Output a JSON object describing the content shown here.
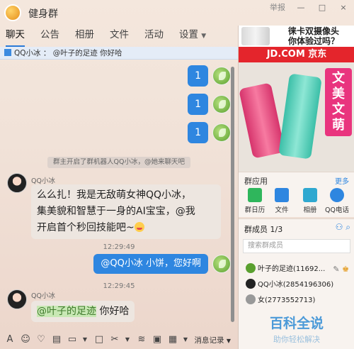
{
  "window": {
    "title": "健身群",
    "report_label": "举报",
    "controls": [
      "—",
      "□",
      "×"
    ]
  },
  "tabs": [
    {
      "label": "聊天",
      "active": true
    },
    {
      "label": "公告"
    },
    {
      "label": "相册"
    },
    {
      "label": "文件"
    },
    {
      "label": "活动"
    },
    {
      "label": "设置",
      "dropdown": true
    }
  ],
  "notice": "QQ小冰 ： @叶子的足迹 你好哈",
  "chat": {
    "messages_right_ones": [
      "1",
      "1",
      "1"
    ],
    "system_text": "群主开启了群机器人QQ小冰，@她来聊天吧",
    "bot_name": "QQ小冰",
    "bot_msg_lines": [
      "么么扎！我是无敌萌女神QQ小冰，",
      "集美貌和智慧于一身的AI宝宝，@我",
      "开启首个秒回技能吧~"
    ],
    "time1": "12:29:49",
    "my_msg": "@QQ小冰  小饼，您好啊",
    "time2": "12:29:45",
    "bot_name2": "QQ小冰",
    "bot_reply_mention": "@叶子的足迹",
    "bot_reply_text": " 你好哈"
  },
  "toolbar": {
    "icons": [
      "font-icon",
      "emoji-icon",
      "vip-emoji-icon",
      "gif-icon",
      "image-icon",
      "folder-icon",
      "screenshot-icon",
      "shake-icon",
      "red-packet-icon",
      "more-icon"
    ],
    "message_record": "消息记录"
  },
  "ad": {
    "text_line1": "徕卡双摄像头",
    "text_line2": "你体验过吗？",
    "jd_brand": "JD.COM 京东",
    "slogan": [
      "文",
      "美",
      "文",
      "萌"
    ]
  },
  "group_apps": {
    "title": "群应用",
    "more": "更多",
    "items": [
      {
        "label": "群日历",
        "color": "#2fb65c"
      },
      {
        "label": "文件",
        "color": "#2e86e0"
      },
      {
        "label": "相册",
        "color": "#2fa8d0"
      },
      {
        "label": "QQ电话",
        "color": "#2e86e0"
      }
    ]
  },
  "members": {
    "title": "群成员 1/3",
    "search_placeholder": "搜索群成员",
    "list": [
      {
        "name": "叶子的足迹(11692...",
        "color": "#5aa02f"
      },
      {
        "name": "QQ小冰(2854196306)",
        "color": "#222222"
      },
      {
        "name": "女(2773552713)",
        "color": "#999999"
      }
    ]
  },
  "watermark": {
    "title": "百科全说",
    "subtitle": "助你轻松解决"
  }
}
